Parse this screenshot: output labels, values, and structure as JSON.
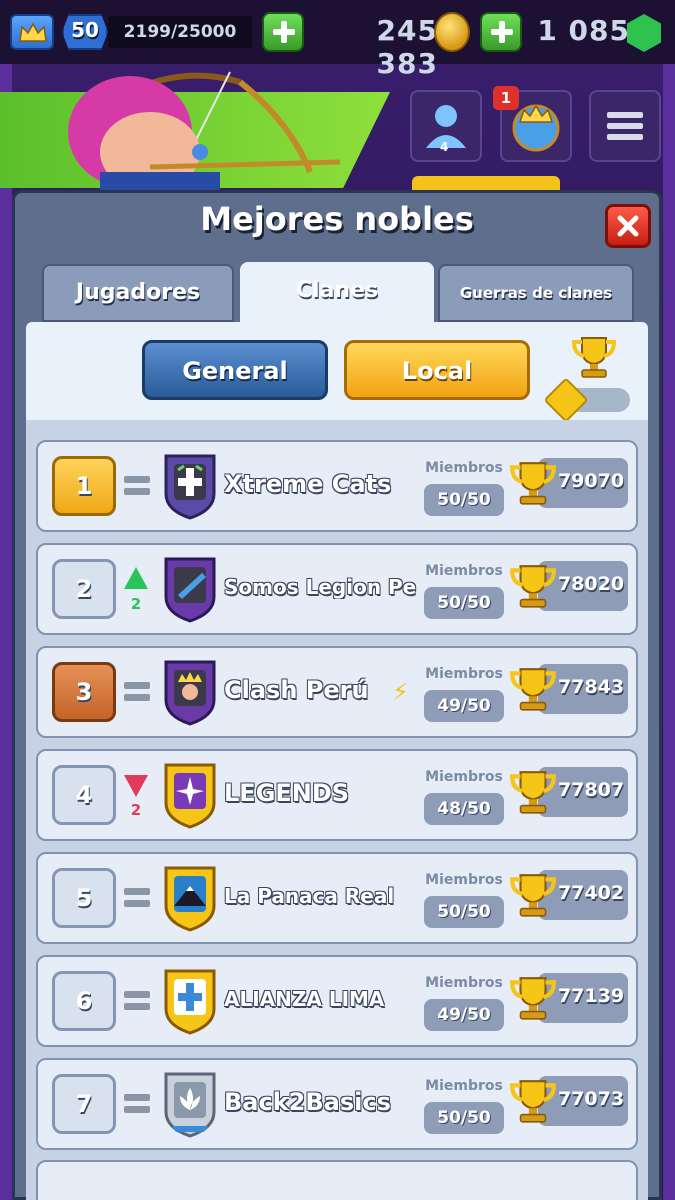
{
  "topbar": {
    "level": "50",
    "xp": "2199/25000",
    "gold": "245 383",
    "gems": "1 085",
    "icons": [
      "crown-icon",
      "plus-icon",
      "gold-coin-icon",
      "plus-icon",
      "gem-icon"
    ]
  },
  "side": {
    "friends_count": "4",
    "notification_count": "1"
  },
  "panel": {
    "title": "Mejores nobles",
    "tabs": [
      {
        "label": "Jugadores",
        "active": false
      },
      {
        "label": "Clanes",
        "active": true
      },
      {
        "label": "Guerras de clanes",
        "active": false
      }
    ],
    "filters": {
      "general": "General",
      "local": "Local",
      "selected": "Local"
    }
  },
  "clans": [
    {
      "rank": "1",
      "name": "Xtreme Cats",
      "movement": "same",
      "move_amount": "",
      "members_label": "Miembros",
      "members": "50/50",
      "trophies": "79070",
      "badge_color": "#5b4ba8",
      "badge_symbol": "cross"
    },
    {
      "rank": "2",
      "name": "Somos Legion Pe",
      "movement": "up",
      "move_amount": "2",
      "members_label": "Miembros",
      "members": "50/50",
      "trophies": "78020",
      "badge_color": "#6a3ba8",
      "badge_symbol": "sword"
    },
    {
      "rank": "3",
      "name": "Clash Perú",
      "movement": "same",
      "move_amount": "",
      "members_label": "Miembros",
      "members": "49/50",
      "trophies": "77843",
      "badge_color": "#6a3ba8",
      "badge_symbol": "king",
      "extra_icon": "lightning-icon"
    },
    {
      "rank": "4",
      "name": "LEGENDS",
      "movement": "down",
      "move_amount": "2",
      "members_label": "Miembros",
      "members": "48/50",
      "trophies": "77807",
      "badge_color": "#7a3ab8",
      "badge_symbol": "star"
    },
    {
      "rank": "5",
      "name": "La Panaca Real",
      "movement": "same",
      "move_amount": "",
      "members_label": "Miembros",
      "members": "50/50",
      "trophies": "77402",
      "badge_color": "#2a80c8",
      "badge_symbol": "mountain"
    },
    {
      "rank": "6",
      "name": "ALIANZA LIMA",
      "movement": "same",
      "move_amount": "",
      "members_label": "Miembros",
      "members": "49/50",
      "trophies": "77139",
      "badge_color": "#3a8ad8",
      "badge_symbol": "cross"
    },
    {
      "rank": "7",
      "name": "Back2Basics",
      "movement": "same",
      "move_amount": "",
      "members_label": "Miembros",
      "members": "50/50",
      "trophies": "77073",
      "badge_color": "#8a9aaa",
      "badge_symbol": "lotus"
    }
  ],
  "colors": {
    "accent_gold": "#f0a818",
    "rank_bronze": "#c46428",
    "up": "#2ac45a",
    "down": "#e23a5c"
  }
}
